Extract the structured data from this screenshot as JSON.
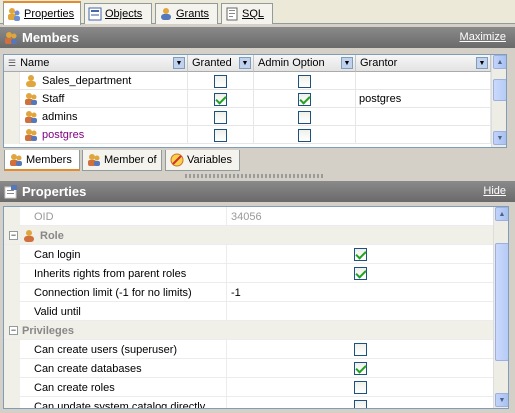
{
  "top_tabs": [
    {
      "label": "Properties",
      "icon": "user-group-icon",
      "active": true
    },
    {
      "label": "Objects",
      "icon": "objects-icon"
    },
    {
      "label": "Grants",
      "icon": "user-icon"
    },
    {
      "label": "SQL",
      "icon": "sql-icon"
    }
  ],
  "members": {
    "title": "Members",
    "maximize_label": "Maximize",
    "columns": [
      "Name",
      "Granted",
      "Admin Option",
      "Grantor"
    ],
    "rows": [
      {
        "name": "Sales_department",
        "granted": false,
        "admin": false,
        "grantor": "",
        "icon": "user-icon"
      },
      {
        "name": "Staff",
        "granted": true,
        "admin": true,
        "grantor": "postgres",
        "icon": "group-icon"
      },
      {
        "name": "admins",
        "granted": false,
        "admin": false,
        "grantor": "",
        "icon": "group-icon"
      },
      {
        "name": "postgres",
        "granted": false,
        "admin": false,
        "grantor": "",
        "icon": "group-icon"
      }
    ]
  },
  "bottom_tabs": [
    {
      "label": "Members",
      "active": true
    },
    {
      "label": "Member of"
    },
    {
      "label": "Variables"
    }
  ],
  "properties": {
    "title": "Properties",
    "hide_label": "Hide",
    "oid_label": "OID",
    "oid_value": "34056",
    "role_category": "Role",
    "role_rows": [
      {
        "label": "Can login",
        "checked": true
      },
      {
        "label": "Inherits rights from parent roles",
        "checked": true
      },
      {
        "label": "Connection limit (-1 for no limits)",
        "value": "-1"
      },
      {
        "label": "Valid until",
        "value": ""
      }
    ],
    "priv_category": "Privileges",
    "priv_rows": [
      {
        "label": "Can create users (superuser)",
        "checked": false
      },
      {
        "label": "Can create databases",
        "checked": true
      },
      {
        "label": "Can create roles",
        "checked": false
      },
      {
        "label": "Can update system catalog directly",
        "checked": false
      }
    ]
  },
  "colors": {
    "accent": "#e68b2c",
    "header": "#6f6f6f",
    "check": "#21a121"
  }
}
